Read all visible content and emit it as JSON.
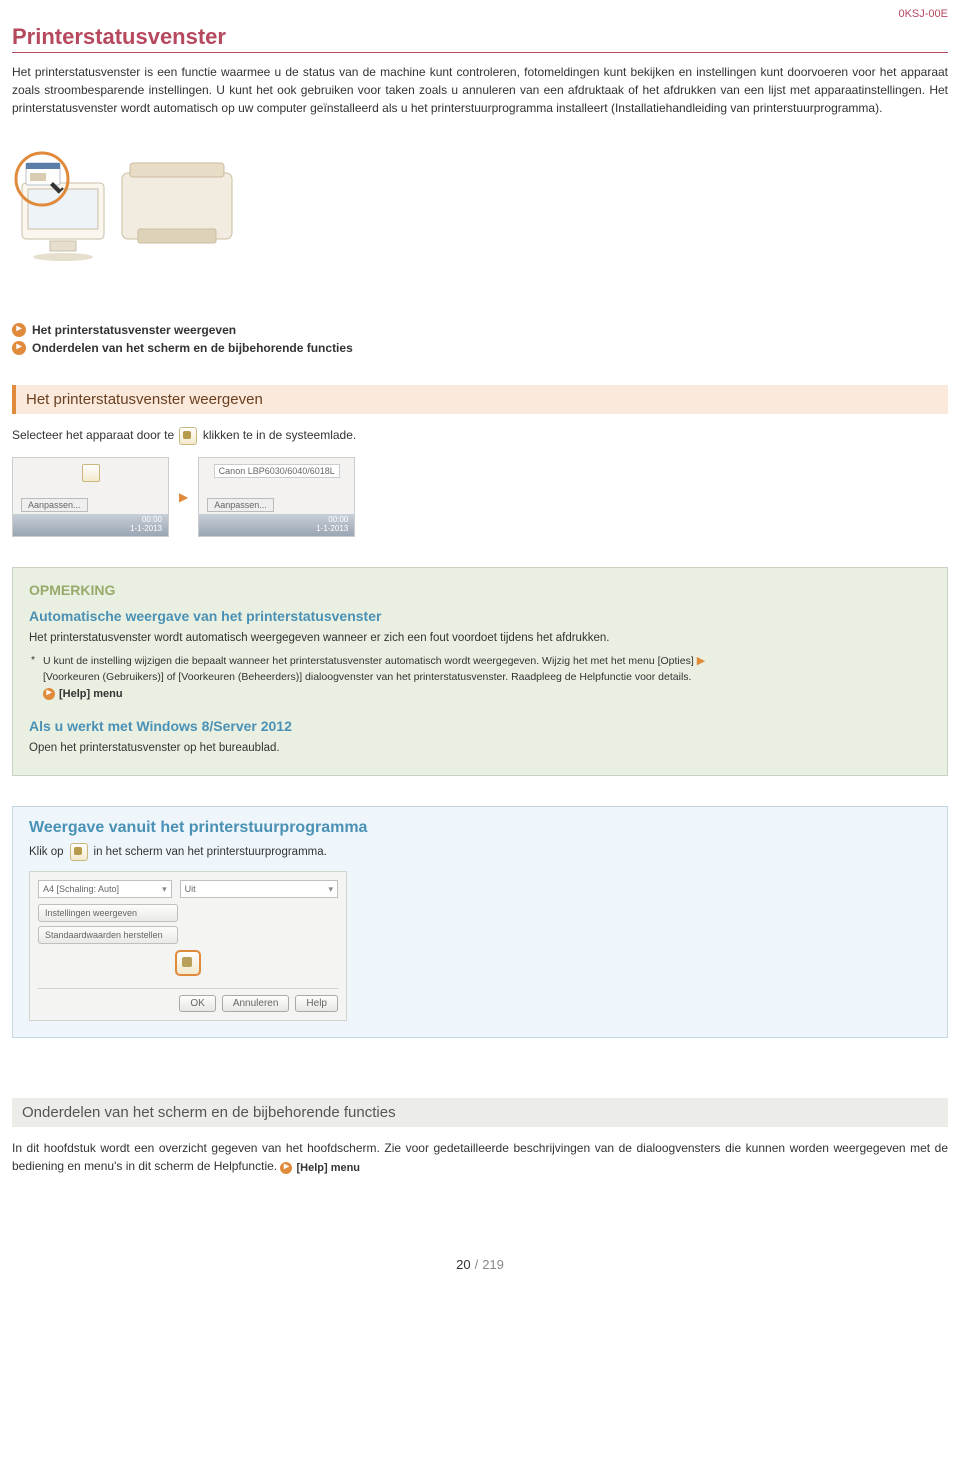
{
  "doc_code": "0KSJ-00E",
  "title": "Printerstatusvenster",
  "intro": "Het printerstatusvenster is een functie waarmee u de status van de machine kunt controleren, fotomeldingen kunt bekijken en instellingen kunt doorvoeren voor het apparaat zoals stroombesparende instellingen. U kunt het ook gebruiken voor taken zoals u annuleren van een afdruktaak of het afdrukken van een lijst met apparaatinstellingen. Het printerstatusvenster wordt automatisch op uw computer geïnstalleerd als u het printerstuurprogramma installeert (Installatiehandleiding van printerstuurprogramma).",
  "toc": {
    "item1": "Het printerstatusvenster weergeven",
    "item2": "Onderdelen van het scherm en de bijbehorende functies"
  },
  "section1_header": "Het printerstatusvenster weergeven",
  "section1_text_a": "Selecteer het apparaat door te",
  "section1_text_b": "klikken te in de systeemlade.",
  "tray": {
    "tooltip": "Canon LBP6030/6040/6018L",
    "btn": "Aanpassen...",
    "time": "00:00",
    "date": "1-1-2013"
  },
  "note": {
    "label": "OPMERKING",
    "h1": "Automatische weergave van het printerstatusvenster",
    "p1": "Het printerstatusvenster wordt automatisch weergegeven wanneer er zich een fout voordoet tijdens het afdrukken.",
    "star": "U kunt de instelling wijzigen die bepaalt wanneer het printerstatusvenster automatisch wordt weergegeven. Wijzig het met het menu [Opties]",
    "star2": "[Voorkeuren (Gebruikers)] of [Voorkeuren (Beheerders)] dialoogvenster van het printerstatusvenster. Raadpleeg de Helpfunctie voor details.",
    "help": "[Help] menu",
    "h2": "Als u werkt met Windows 8/Server 2012",
    "p2": "Open het printerstatusvenster op het bureaublad."
  },
  "callout": {
    "h": "Weergave vanuit het printerstuurprogramma",
    "a": "Klik op",
    "b": "in het scherm van het printerstuurprogramma."
  },
  "driver": {
    "sel1": "A4 [Schaling: Auto]",
    "sel2": "Uit",
    "btn1": "Instellingen weergeven",
    "btn2": "Standaardwaarden herstellen",
    "ok": "OK",
    "cancel": "Annuleren",
    "help": "Help"
  },
  "section2_header": "Onderdelen van het scherm en de bijbehorende functies",
  "section2_text": "In dit hoofdstuk wordt een overzicht gegeven van het hoofdscherm. Zie voor gedetailleerde beschrijvingen van de dialoogvensters die kunnen worden weergegeven met de bediening en menu's in dit scherm de Helpfunctie.",
  "section2_help": "[Help] menu",
  "page": {
    "current": "20",
    "total": "219"
  }
}
